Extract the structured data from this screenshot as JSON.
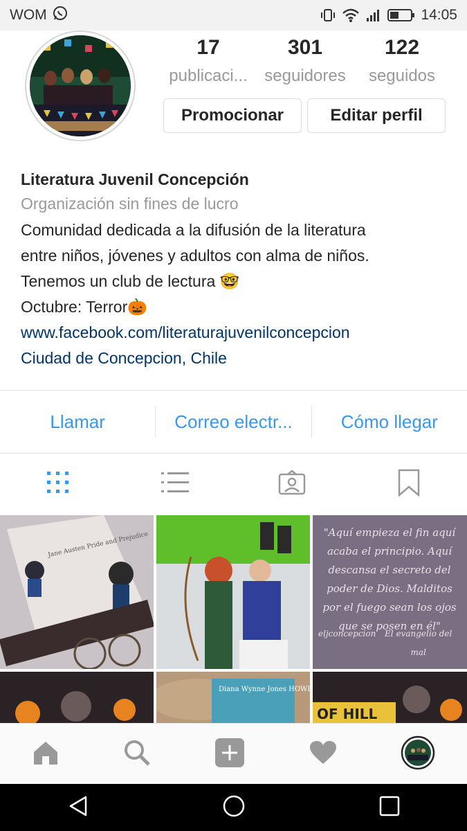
{
  "status_bar": {
    "carrier": "WOM",
    "time": "14:05"
  },
  "profile": {
    "stats": [
      {
        "value": "17",
        "label": "publicaci..."
      },
      {
        "value": "301",
        "label": "seguidores"
      },
      {
        "value": "122",
        "label": "seguidos"
      }
    ],
    "buttons": {
      "promote": "Promocionar",
      "edit": "Editar perfil"
    }
  },
  "bio": {
    "name": "Literatura Juvenil Concepción",
    "category": "Organización sin fines de lucro",
    "lines": [
      "Comunidad dedicada a la difusión de la literatura",
      "entre niños, jóvenes y adultos con alma de niños.",
      "Tenemos un club de lectura 🤓",
      "Octubre: Terror🎃"
    ],
    "website": "www.facebook.com/literaturajuvenilconcepcion",
    "location": "Ciudad de Concepcion, Chile"
  },
  "contact_actions": {
    "call": "Llamar",
    "email": "Correo electr...",
    "directions": "Cómo llegar"
  },
  "posts": {
    "quote_text": "\"Aquí empieza el fin aquí acaba el principio. Aquí descansa el secreto del poder de Dios. Malditos por el fuego sean los ojos que se posen en él\"",
    "quote_handle": "eljconcepcion",
    "quote_source": "El evangelio del mal",
    "book_cover_1": "Jane Austen Pride and Prejudice",
    "book_cover_2": "Diana Wynne Jones HOWL'S MOVING CASTLE",
    "book_cover_3": "OF HILL"
  },
  "colors": {
    "link": "#003569",
    "accent": "#3897f0",
    "muted": "#999999",
    "active_tab": "#3897f0"
  }
}
